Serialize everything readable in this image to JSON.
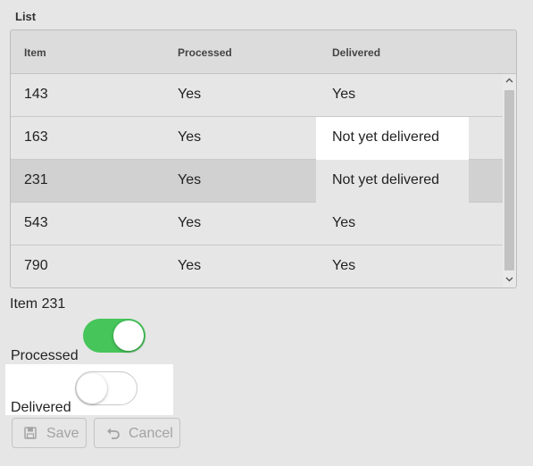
{
  "list": {
    "title": "List",
    "columns": [
      "Item",
      "Processed",
      "Delivered"
    ],
    "rows": [
      {
        "item": "143",
        "processed": "Yes",
        "delivered": "Yes",
        "selected": false
      },
      {
        "item": "163",
        "processed": "Yes",
        "delivered": "Not yet delivered",
        "selected": false
      },
      {
        "item": "231",
        "processed": "Yes",
        "delivered": "Not yet delivered",
        "selected": true
      },
      {
        "item": "543",
        "processed": "Yes",
        "delivered": "Yes",
        "selected": false
      },
      {
        "item": "790",
        "processed": "Yes",
        "delivered": "Yes",
        "selected": false
      }
    ]
  },
  "detail": {
    "item_label": "Item 231",
    "processed_label": "Processed",
    "processed_on": true,
    "delivered_label": "Delivered",
    "delivered_on": false
  },
  "buttons": {
    "save_label": "Save",
    "cancel_label": "Cancel"
  },
  "colors": {
    "toggle_on": "#46c55a",
    "selected_row": "#d1d1d1",
    "highlight": "#ffffff"
  }
}
